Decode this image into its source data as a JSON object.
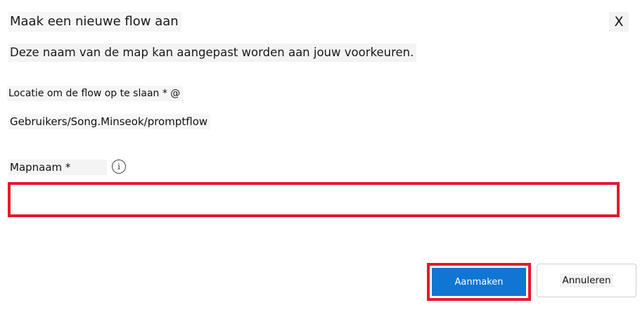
{
  "dialog": {
    "title": "Maak een nieuwe flow aan",
    "close_label": "X",
    "description": "Deze naam van de map kan aangepast worden aan jouw voorkeuren."
  },
  "location": {
    "label": "Locatie om de flow op te slaan * @",
    "path": "Gebruikers/Song.Minseok/promptflow"
  },
  "folder_name": {
    "label": "Mapnaam *",
    "info_icon": "info-icon",
    "info_glyph": "i",
    "value": "",
    "placeholder": ""
  },
  "buttons": {
    "create_label": "Aanmaken",
    "cancel_label": "Annuleren"
  },
  "colors": {
    "primary": "#0f76d4",
    "highlight": "#e5192c"
  }
}
